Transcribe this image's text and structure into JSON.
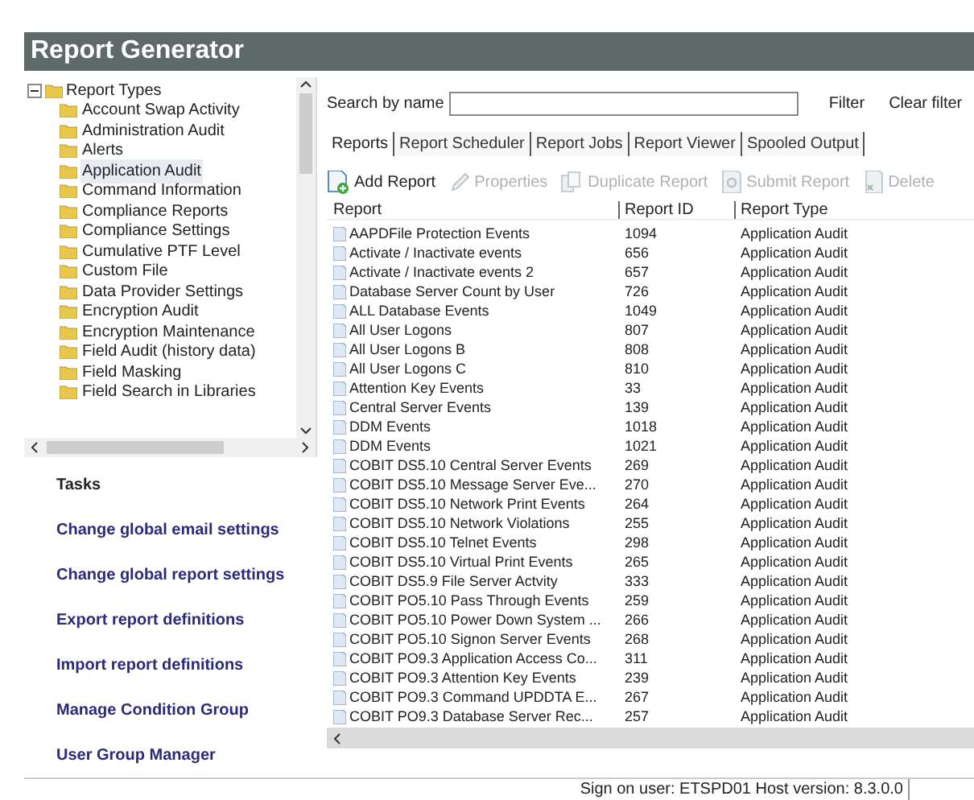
{
  "window": {
    "title": "Report Generator"
  },
  "tree": {
    "label": "Report Types",
    "expanded": true,
    "children": [
      {
        "label": "Account Swap Activity",
        "selected": false
      },
      {
        "label": "Administration Audit",
        "selected": false
      },
      {
        "label": "Alerts",
        "selected": false
      },
      {
        "label": "Application Audit",
        "selected": true
      },
      {
        "label": "Command Information",
        "selected": false
      },
      {
        "label": "Compliance Reports",
        "selected": false
      },
      {
        "label": "Compliance Settings",
        "selected": false
      },
      {
        "label": "Cumulative PTF Level",
        "selected": false
      },
      {
        "label": "Custom File",
        "selected": false
      },
      {
        "label": "Data Provider Settings",
        "selected": false
      },
      {
        "label": "Encryption Audit",
        "selected": false
      },
      {
        "label": "Encryption Maintenance",
        "selected": false
      },
      {
        "label": "Field Audit (history data)",
        "selected": false
      },
      {
        "label": "Field Masking",
        "selected": false
      },
      {
        "label": "Field Search in Libraries",
        "selected": false
      }
    ]
  },
  "tasks": {
    "title": "Tasks",
    "links": [
      "Change global email settings",
      "Change global report settings",
      "Export report definitions",
      "Import report definitions",
      "Manage Condition Group",
      "User Group Manager"
    ]
  },
  "search": {
    "label": "Search by name",
    "filter": "Filter",
    "clear": "Clear filter"
  },
  "tabs": [
    {
      "label": "Reports",
      "selected": true
    },
    {
      "label": "Report Scheduler",
      "selected": false
    },
    {
      "label": "Report Jobs",
      "selected": false
    },
    {
      "label": "Report Viewer",
      "selected": false
    },
    {
      "label": "Spooled Output",
      "selected": false
    }
  ],
  "toolbar": [
    {
      "kind": "add",
      "label": "Add Report",
      "disabled": false
    },
    {
      "kind": "properties",
      "label": "Properties",
      "disabled": true
    },
    {
      "kind": "duplicate",
      "label": "Duplicate Report",
      "disabled": true
    },
    {
      "kind": "submit",
      "label": "Submit Report",
      "disabled": true
    },
    {
      "kind": "delete",
      "label": "Delete",
      "disabled": true
    }
  ],
  "table": {
    "columns": [
      "Report",
      "Report ID",
      "Report Type"
    ],
    "rows": [
      [
        "AAPDFile Protection Events",
        "1094",
        "Application Audit"
      ],
      [
        "Activate / Inactivate events",
        "656",
        "Application Audit"
      ],
      [
        "Activate / Inactivate events 2",
        "657",
        "Application Audit"
      ],
      [
        "Database Server Count by User",
        "726",
        "Application Audit"
      ],
      [
        "ALL Database Events",
        "1049",
        "Application Audit"
      ],
      [
        "All User Logons",
        "807",
        "Application Audit"
      ],
      [
        "All User Logons B",
        "808",
        "Application Audit"
      ],
      [
        "All User Logons C",
        "810",
        "Application Audit"
      ],
      [
        "Attention Key Events",
        "33",
        "Application Audit"
      ],
      [
        "Central Server Events",
        "139",
        "Application Audit"
      ],
      [
        "DDM Events",
        "1018",
        "Application Audit"
      ],
      [
        "DDM Events",
        "1021",
        "Application Audit"
      ],
      [
        "COBIT DS5.10 Central Server Events",
        "269",
        "Application Audit"
      ],
      [
        "COBIT DS5.10 Message Server Eve...",
        "270",
        "Application Audit"
      ],
      [
        "COBIT DS5.10 Network Print Events",
        "264",
        "Application Audit"
      ],
      [
        "COBIT DS5.10 Network Violations",
        "255",
        "Application Audit"
      ],
      [
        "COBIT DS5.10 Telnet Events",
        "298",
        "Application Audit"
      ],
      [
        "COBIT DS5.10 Virtual Print Events",
        "265",
        "Application Audit"
      ],
      [
        "COBIT DS5.9 File Server Actvity",
        "333",
        "Application Audit"
      ],
      [
        "COBIT PO5.10 Pass Through Events",
        "259",
        "Application Audit"
      ],
      [
        "COBIT PO5.10 Power Down System ...",
        "266",
        "Application Audit"
      ],
      [
        "COBIT PO5.10 Signon Server Events",
        "268",
        "Application Audit"
      ],
      [
        "COBIT PO9.3 Application Access Co...",
        "311",
        "Application Audit"
      ],
      [
        "COBIT PO9.3 Attention Key Events",
        "239",
        "Application Audit"
      ],
      [
        "COBIT PO9.3 Command UPDDTA E...",
        "267",
        "Application Audit"
      ],
      [
        "COBIT PO9.3 Database Server Rec...",
        "257",
        "Application Audit"
      ]
    ]
  },
  "status_bar": "Sign on user: ETSPD01 Host version: 8.3.0.0"
}
